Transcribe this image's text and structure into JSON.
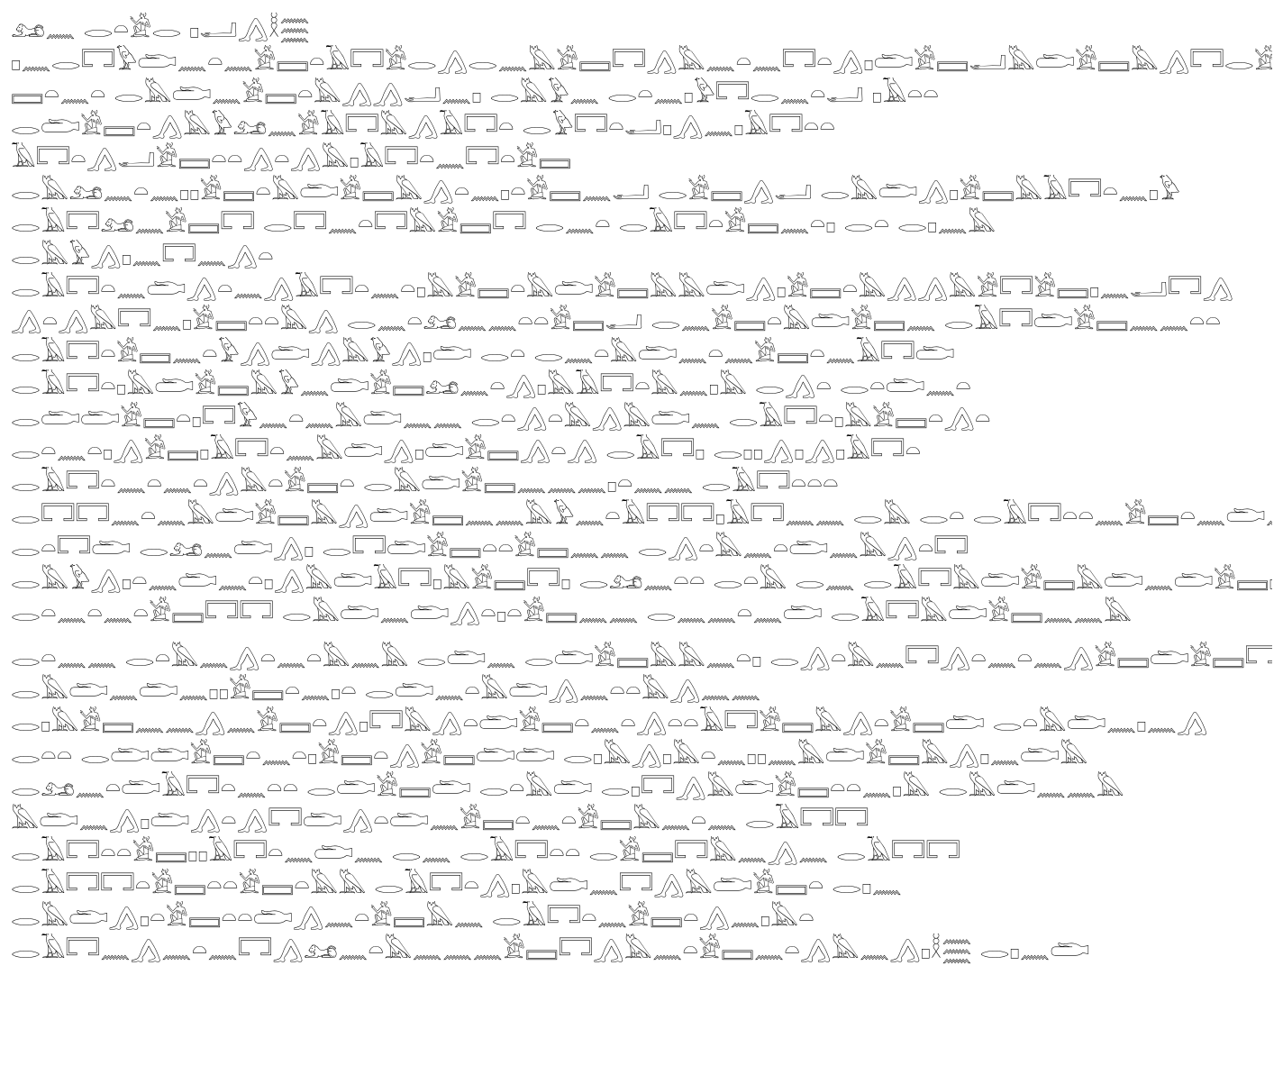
{
  "paragraphs": [
    {
      "lines": [
        "𓃭𓈖 𓂋𓏏𓀀𓂋 𓊪𓂝𓂻𓎛𓈗",
        "𓊪𓈖𓂋𓉐𓅱𓂧𓈖𓏏𓈖𓀀𓈙𓏏𓄿𓉐𓀀𓂋𓂻𓂋𓈖𓅓𓀀𓈙𓉐𓂻𓅓𓈖𓏏𓈖𓉐𓏏𓂻𓊪𓂧𓀀𓈙𓂝𓅓𓂧𓀀𓈙𓅓𓂻𓉐𓂋𓀀",
        "𓈙𓏏𓈖𓏏 𓂋𓅓𓂧𓈖𓀀𓈙𓏏𓅓𓂻𓂻𓂝𓈖𓊪 𓂋𓅓𓅱𓈖 𓂋𓏏𓈖𓊪𓅱𓉐𓂋𓈖𓏏𓂝 𓊪𓄿𓏏𓏏",
        "𓂋𓂧𓀀𓈙𓏏𓂻𓅓𓅱𓃭𓈖𓀀𓄿𓉐𓅓𓂻𓄿𓉐𓏏 𓂋𓅱𓉐𓏏𓂝𓊪𓂻𓈖𓊪𓄿𓉐𓏏𓏏",
        "𓄿𓉐𓏏𓂻𓂝𓀀𓈙𓏏𓏏𓂻𓏏𓂻𓅓𓊪𓄿𓉐𓏏𓈖𓉐𓏏𓀀𓈙"
      ]
    },
    {
      "lines": [
        "𓂋𓅓𓃭𓈖𓏏𓈖𓊪𓊪𓀀𓈙𓏏𓅓𓂧𓀀𓈙𓅓𓂻𓏏𓈖𓊪𓏏𓀀𓈙𓈖𓂝 𓂋𓀀𓈙𓂻𓂝 𓂋𓅓𓂧𓂻𓊪𓀀𓈙𓅓𓄿𓉐𓏏𓈖𓊪𓅱",
        "𓂋𓄿𓉐𓃭𓈖𓀀𓈙𓉐 𓂋𓉐𓈖𓏏𓉐𓅓𓀀𓈙𓉐 𓂋𓈖𓏏 𓂋𓄿𓉐𓏏𓀀𓈙𓈖𓏏𓊪 𓂋𓏏 𓂋𓊪𓈖𓅓",
        "𓂋𓅓𓅱𓂻𓊪𓈖𓉐𓈖𓂻𓏏"
      ]
    },
    {
      "lines": [
        "𓂋𓄿𓉐𓏏𓈖𓂧𓂻𓏏𓈖𓂻𓄿𓉐𓏏𓈖𓏏𓊪𓅓𓀀𓈙𓏏𓅓𓂧𓀀𓈙𓅓𓅓𓂧𓂻𓊪𓀀𓈙𓏏𓅓𓂻𓂻𓅓𓀀𓉐𓀀𓈙𓊪𓈖𓂝𓉐𓂻",
        "𓂻𓏏𓂻𓅓𓉐𓈖𓊪𓀀𓈙𓏏𓏏𓅓𓂻 𓂋𓈖𓏏𓃭𓈖𓈖𓏏𓏏𓀀𓈙𓂝 𓂋𓈖𓀀𓈙𓏏𓅓𓂧𓀀𓈙𓈖 𓂋𓄿𓉐𓂧𓀀𓈙𓈖𓈖𓏏𓏏",
        "𓂋𓄿𓉐𓏏𓀀𓈙𓈖𓏏𓅱𓂻𓂧𓂻𓅓𓅱𓂻𓊪𓂧 𓂋𓏏 𓂋𓈖𓏏𓅓𓂧𓈖𓏏𓈖𓀀𓈙𓏏𓈖𓄿𓉐𓂧",
        "𓂋𓄿𓉐𓏏𓊪𓅓𓂧𓀀𓈙𓅓𓅱𓈖𓂧𓀀𓈙𓃭𓈖𓏏𓂻𓊪𓅓𓄿𓉐𓏏𓅓𓈖𓊪𓅓 𓂋𓂻𓏏 𓂋𓏏𓂧𓈖𓏏",
        "𓂋𓂧𓂧𓀀𓈙𓏏𓊪𓉐𓅱𓈖𓏏𓈖𓅓𓂧𓈖𓈖 𓂋𓏏𓂻𓏏𓅓𓂻𓅓𓂧𓈖 𓂋𓄿𓉐𓏏𓊪𓅓𓀀𓈙𓏏𓂻𓏏",
        "𓂋𓏏𓈖𓏏𓊪𓂻𓀀𓈙𓊪𓄿𓉐𓏏𓈖𓅓𓂧𓂻𓊪𓂧𓀀𓈙𓂻𓏏𓂻 𓂋𓄿𓉐𓊪 𓂋𓊪𓊪𓂻𓊪𓂻𓊪𓄿𓉐𓏏",
        "𓂋𓄿𓉐𓏏𓈖𓏏𓈖𓏏𓂻𓅓𓏏𓀀𓈙𓏏 𓂋𓅓𓂧𓀀𓈙𓈖𓈖𓈖𓊪𓏏𓈖𓈖 𓂋𓄿𓉐𓏏𓏏𓏏",
        "𓂋𓉐𓉐𓈖𓏏𓈖𓅓𓂧𓀀𓈙𓅓𓂻𓂧𓀀𓈙𓈖𓈖𓅓𓅱𓈖𓏏𓄿𓉐𓉐𓊪𓄿𓉐𓈖𓈖 𓂋𓅓 𓂋𓏏 𓂋𓄿𓉐𓏏𓏏𓈖𓀀𓈙𓏏𓈖𓂧𓈖𓏏",
        "𓂋𓏏𓉐𓂧 𓂋𓃭𓈖𓂧𓂻𓊪 𓂋𓉐𓂧𓀀𓈙𓏏𓏏𓀀𓈙𓈖𓈖 𓂋𓂻𓏏𓅓𓈖𓏏𓂧𓈖𓅓𓂻𓏏𓉐",
        "𓂋𓅓𓅱𓂻𓊪𓏏𓈖𓂧𓈖𓏏𓊪𓂻𓅓𓂧𓄿𓉐𓊪𓅓𓀀𓈙𓉐𓊪 𓂋𓃭𓈖𓏏𓏏 𓂋𓏏𓅓 𓂋𓈖 𓂋𓄿𓉐𓅓𓂧𓀀𓈙𓅓𓂧𓈖𓂧𓀀𓈙𓊪",
        "𓂋𓏏𓈖𓏏𓈖𓏏𓀀𓈙𓉐𓉐 𓂋𓅓𓂧𓈖𓂧𓂻𓏏𓊪𓏏𓀀𓈙𓈖𓈖 𓂋𓈖𓈖𓏏𓈖𓂧 𓂋𓄿𓉐𓅓𓂧𓀀𓈙𓈖𓈖𓅓"
      ]
    },
    {
      "lines": [
        "𓂋𓏏𓈖𓈖 𓂋𓏏𓅓𓈖𓂻𓏏𓈖𓏏𓅓𓈖𓅓 𓂋𓂧𓈖 𓂋𓂧𓀀𓈙𓅓𓅓𓈖𓏏𓊪 𓂋𓂻𓏏𓅓𓈖𓉐𓂻𓏏𓈖𓏏𓈖𓂻𓀀𓈙𓂧𓀀𓈙𓉐𓀀𓈙𓈖𓏏𓈖",
        "𓂋𓅓𓂧𓈖𓂧𓈖𓊪𓊪𓀀𓈙𓏏𓈖𓊪𓏏 𓂋𓂧𓈖𓏏𓅓𓂧𓂻𓈖𓏏𓏏𓅓𓂻𓈖𓈖",
        "𓂋𓊪𓅓𓀀𓈙𓈖𓈖𓂻𓈖𓀀𓈙𓏏𓂻𓊪𓉐𓅓𓂻𓏏𓂧𓀀𓈙𓏏𓈖𓏏𓂻𓏏𓏏𓄿𓉐𓀀𓈙𓅓𓂻𓏏𓀀𓈙𓂧 𓂋𓏏𓅓𓂧𓈖𓊪𓈖𓂻",
        "𓂋𓏏𓏏 𓂋𓂧𓂧𓀀𓈙𓏏𓈖𓏏𓊪𓀀𓈙𓏏𓂻𓀀𓈙𓂧𓂧 𓂋𓊪𓅓𓂻𓊪𓅓𓏏𓈖𓊪𓊪𓈖𓅓𓂧𓀀𓈙𓅓𓂻𓊪𓈖𓂧𓅓",
        "𓂋𓃭𓈖𓏏𓂧𓄿𓉐𓏏𓈖𓏏𓏏 𓂋𓂧𓀀𓈙𓂧 𓂋𓏏𓅓𓂧 𓂋𓊪𓉐𓂻𓅓𓂧𓀀𓈙𓏏𓏏𓈖𓊪𓅓 𓂋𓅓𓂧𓈖𓈖𓅓",
        "𓅓𓂧𓈖𓂻𓊪𓂧𓂻𓏏𓂻𓉐𓂧𓂻𓏏𓂧𓈖𓀀𓈙𓏏𓈖𓏏𓀀𓈙𓅓𓈖𓏏𓈖 𓂋𓄿𓉐𓉐",
        "𓂋𓄿𓉐𓏏𓏏𓀀𓈙𓊪𓊪𓄿𓉐𓏏𓈖𓂧𓈖 𓂋𓈖 𓂋𓄿𓉐𓏏𓏏 𓂋𓀀𓈙𓉐𓅓𓈖𓂻𓈖 𓂋𓄿𓉐𓉐",
        "𓂋𓄿𓉐𓉐𓏏𓀀𓈙𓏏𓏏𓀀𓈙𓏏𓅓𓅓 𓂋𓄿𓉐𓏏𓂻𓊪𓅓𓂧𓈖𓉐𓂻𓅓𓂧𓀀𓈙𓏏 𓂋𓊪𓈖",
        "𓂋𓅓𓂧𓂻𓊪𓏏𓀀𓈙𓏏𓏏𓂧𓂻𓈖𓏏𓀀𓈙𓅓𓈖 𓂋𓄿𓉐𓏏𓈖𓀀𓈙𓏏𓂻𓈖𓊪𓅓𓏏",
        "𓂋𓄿𓉐𓈖𓂻𓈖𓏏𓈖𓉐𓂻𓃭𓈖𓏏𓅓𓈖𓈖𓈖𓀀𓈙𓉐𓂻𓅓𓈖𓏏𓀀𓈙𓈖𓏏𓂻𓅓𓈖𓂻𓊪𓎛𓈗 𓂋𓊪𓈖𓂧"
      ]
    }
  ]
}
